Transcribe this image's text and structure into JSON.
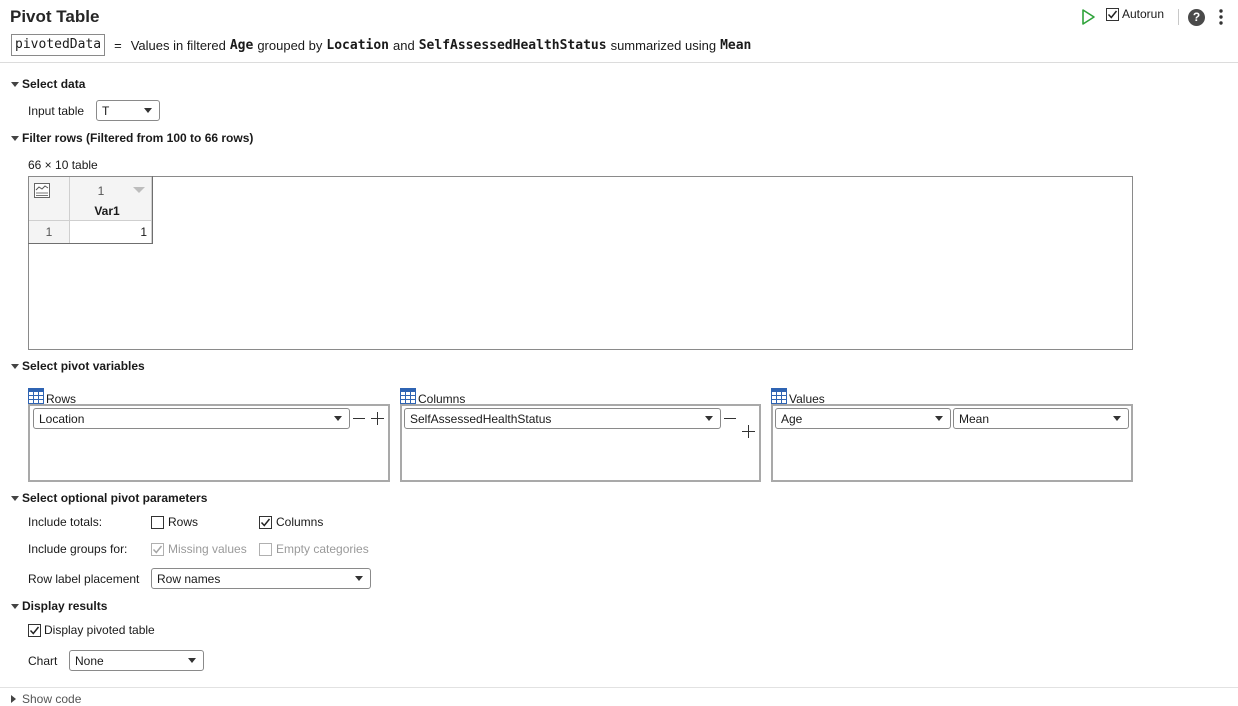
{
  "header": {
    "title": "Pivot Table",
    "autorun_label": "Autorun",
    "autorun_checked": true,
    "help_symbol": "?"
  },
  "summary": {
    "output_var": "pivotedData",
    "equals": "=",
    "text1": "Values in filtered",
    "value_var": "Age",
    "text2": "grouped by",
    "row_var": "Location",
    "text3": "and",
    "col_var": "SelfAssessedHealthStatus",
    "text4": "summarized using",
    "method": "Mean"
  },
  "select_data": {
    "heading": "Select data",
    "input_label": "Input table",
    "input_value": "T"
  },
  "filter_rows": {
    "heading": "Filter rows (Filtered from 100 to 66 rows)",
    "size_label": "66 × 10 table",
    "col_number": "1",
    "col_name": "Var1",
    "row_number": "1",
    "cell_value": "1"
  },
  "pivot_vars": {
    "heading": "Select pivot variables",
    "rows_label": "Rows",
    "rows_value": "Location",
    "columns_label": "Columns",
    "columns_value": "SelfAssessedHealthStatus",
    "values_label": "Values",
    "values_var": "Age",
    "values_method": "Mean"
  },
  "optional": {
    "heading": "Select optional pivot parameters",
    "totals_label": "Include totals:",
    "totals_rows": "Rows",
    "totals_rows_checked": false,
    "totals_columns": "Columns",
    "totals_columns_checked": true,
    "groups_label": "Include groups for:",
    "missing_values": "Missing values",
    "missing_checked": true,
    "empty_categories": "Empty categories",
    "empty_checked": false,
    "placement_label": "Row label placement",
    "placement_value": "Row names"
  },
  "display": {
    "heading": "Display results",
    "display_pivoted": "Display pivoted table",
    "display_checked": true,
    "chart_label": "Chart",
    "chart_value": "None"
  },
  "footer": {
    "show_code": "Show code"
  }
}
